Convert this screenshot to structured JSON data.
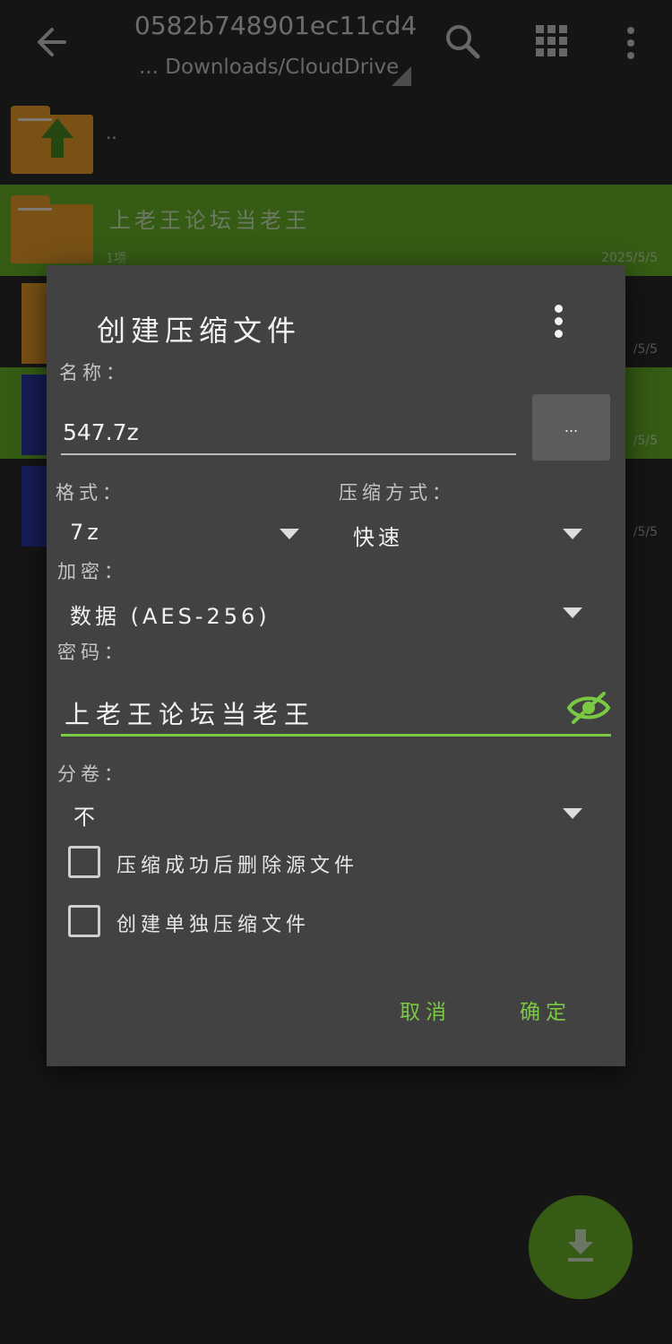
{
  "header": {
    "title": "0582b748901ec11cd4 ...",
    "path": "... Downloads/CloudDrive"
  },
  "files": {
    "parent_label": "..",
    "selected_name": "上老王论坛当老王",
    "selected_info": "1项",
    "selected_date": "2025/5/5",
    "other_dates": [
      "/5/5",
      "/5/5",
      "/5/5"
    ]
  },
  "dialog": {
    "title": "创建压缩文件",
    "name_label": "名称：",
    "name_value": "547.7z",
    "browse_label": "...",
    "format_label": "格式：",
    "format_value": "7z",
    "method_label": "压缩方式：",
    "method_value": "快速",
    "encrypt_label": "加密：",
    "encrypt_value": "数据 (AES-256)",
    "password_label": "密码：",
    "password_value": "上老王论坛当老王",
    "split_label": "分卷：",
    "split_value": "不",
    "option_delete_source": "压缩成功后删除源文件",
    "option_separate": "创建单独压缩文件",
    "cancel": "取消",
    "ok": "确定"
  },
  "colors": {
    "accent": "#7ac943",
    "selection": "#6ab72a",
    "dialog_bg": "#424242",
    "folder": "#f2a22a"
  }
}
